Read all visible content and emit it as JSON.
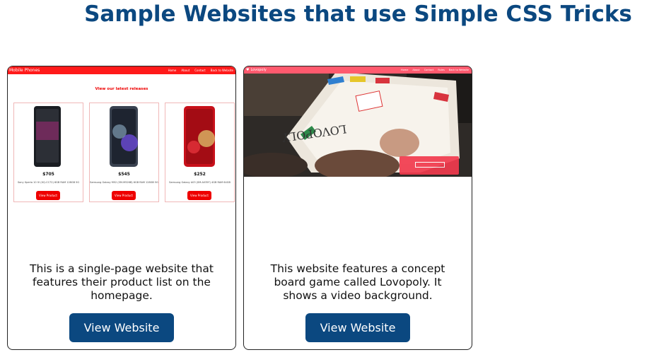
{
  "title": "Sample Websites that use Simple CSS Tricks",
  "cards": [
    {
      "description_lines": [
        "This is a single-page website that",
        "features their product list on the",
        "homepage."
      ],
      "button_label": "View Website",
      "preview": {
        "brand": "Mobile Phones",
        "nav_links": [
          "Home",
          "About",
          "Contact",
          "Back to Website"
        ],
        "heading": "View our latest releases",
        "products": [
          {
            "price": "$705",
            "name": "Sony Xperia 10 IV (XQ-CC72) 6GB RAM 128GB 5G",
            "button": "View Product",
            "color": "#1a1d22",
            "accent": "#8a2a6a"
          },
          {
            "price": "$545",
            "name": "Samsung Galaxy M52 (SM-M526B) 6GB RAM 128GB 5G",
            "button": "View Product",
            "color": "#3a4250",
            "accent": "#6c4bd8"
          },
          {
            "price": "$252",
            "name": "Samsung Galaxy A03 (SM-A035F) 4GB RAM 64GB",
            "button": "View Product",
            "color": "#c8101a",
            "accent": "#e2323a"
          }
        ]
      }
    },
    {
      "description_lines": [
        "This website features a concept",
        "board game called Lovopoly. It",
        "shows a video background."
      ],
      "button_label": "View Website",
      "preview": {
        "brand": "Lovopoly",
        "nav_links": [
          "Home",
          "About",
          "Contact",
          "Rules",
          "Back to Website"
        ],
        "board_text": "LOVOPOLY"
      }
    }
  ],
  "colors": {
    "title": "#0b4880",
    "button": "#0b4880",
    "preview1_nav": "#ff1a1a",
    "preview2_nav": "#ff5a6e"
  }
}
